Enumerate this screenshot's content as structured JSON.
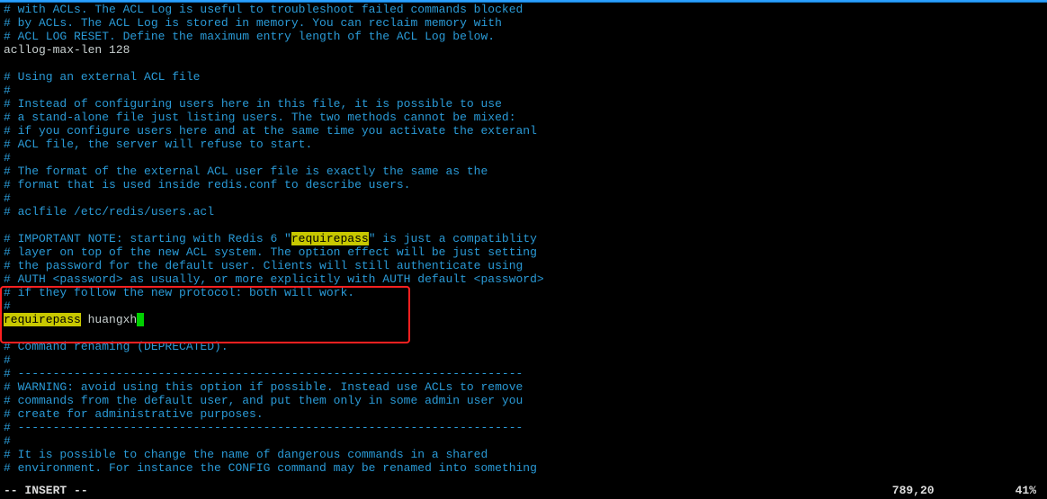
{
  "lines": [
    {
      "type": "comment",
      "text": "# with ACLs. The ACL Log is useful to troubleshoot failed commands blocked"
    },
    {
      "type": "comment",
      "text": "# by ACLs. The ACL Log is stored in memory. You can reclaim memory with"
    },
    {
      "type": "comment",
      "text": "# ACL LOG RESET. Define the maximum entry length of the ACL Log below."
    },
    {
      "type": "config",
      "text": "acllog-max-len 128"
    },
    {
      "type": "blank",
      "text": ""
    },
    {
      "type": "comment",
      "text": "# Using an external ACL file"
    },
    {
      "type": "comment",
      "text": "#"
    },
    {
      "type": "comment",
      "text": "# Instead of configuring users here in this file, it is possible to use"
    },
    {
      "type": "comment",
      "text": "# a stand-alone file just listing users. The two methods cannot be mixed:"
    },
    {
      "type": "comment",
      "text": "# if you configure users here and at the same time you activate the exteranl"
    },
    {
      "type": "comment",
      "text": "# ACL file, the server will refuse to start."
    },
    {
      "type": "comment",
      "text": "#"
    },
    {
      "type": "comment",
      "text": "# The format of the external ACL user file is exactly the same as the"
    },
    {
      "type": "comment",
      "text": "# format that is used inside redis.conf to describe users."
    },
    {
      "type": "comment",
      "text": "#"
    },
    {
      "type": "comment",
      "text": "# aclfile /etc/redis/users.acl"
    },
    {
      "type": "blank",
      "text": ""
    },
    {
      "type": "hl",
      "pre": "# IMPORTANT NOTE: starting with Redis 6 \"",
      "hl": "requirepass",
      "post": "\" is just a compatiblity"
    },
    {
      "type": "comment",
      "text": "# layer on top of the new ACL system. The option effect will be just setting"
    },
    {
      "type": "comment",
      "text": "# the password for the default user. Clients will still authenticate using"
    },
    {
      "type": "comment",
      "text": "# AUTH <password> as usually, or more explicitly with AUTH default <password>"
    },
    {
      "type": "comment",
      "text": "# if they follow the new protocol: both will work."
    },
    {
      "type": "comment",
      "text": "#"
    },
    {
      "type": "cursor",
      "hl": "requirepass",
      "post": " huangxh"
    },
    {
      "type": "blank",
      "text": ""
    },
    {
      "type": "comment",
      "text": "# Command renaming (DEPRECATED)."
    },
    {
      "type": "comment",
      "text": "#"
    },
    {
      "type": "comment",
      "text": "# ------------------------------------------------------------------------"
    },
    {
      "type": "comment",
      "text": "# WARNING: avoid using this option if possible. Instead use ACLs to remove"
    },
    {
      "type": "comment",
      "text": "# commands from the default user, and put them only in some admin user you"
    },
    {
      "type": "comment",
      "text": "# create for administrative purposes."
    },
    {
      "type": "comment",
      "text": "# ------------------------------------------------------------------------"
    },
    {
      "type": "comment",
      "text": "#"
    },
    {
      "type": "comment",
      "text": "# It is possible to change the name of dangerous commands in a shared"
    },
    {
      "type": "comment",
      "text": "# environment. For instance the CONFIG command may be renamed into something"
    }
  ],
  "redbox": {
    "topLine": 21,
    "heightLines": 4
  },
  "status": {
    "mode": "-- INSERT --",
    "position": "789,20",
    "percent": "41%"
  }
}
